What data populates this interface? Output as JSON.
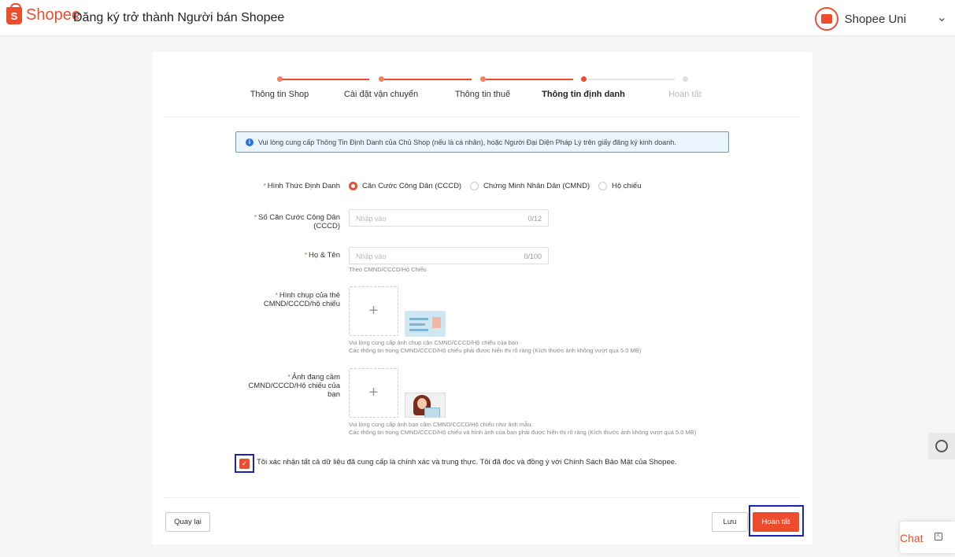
{
  "header": {
    "brand": "Shopee",
    "title": "Đăng ký trở thành Người bán Shopee",
    "account_label": "Shopee Uni"
  },
  "steps": [
    {
      "label": "Thông tin Shop",
      "state": "done"
    },
    {
      "label": "Cài đặt vận chuyển",
      "state": "done"
    },
    {
      "label": "Thông tin thuế",
      "state": "done"
    },
    {
      "label": "Thông tin định danh",
      "state": "active"
    },
    {
      "label": "Hoàn tất",
      "state": "todo"
    }
  ],
  "notice": "Vui lòng cung cấp Thông Tin Định Danh của Chủ Shop (nếu là cá nhân), hoặc Người Đại Diện Pháp Lý trên giấy đăng ký kinh doanh.",
  "form": {
    "id_type": {
      "label": "Hình Thức Định Danh",
      "options": [
        "Căn Cước Công Dân (CCCD)",
        "Chứng Minh Nhân Dân (CMND)",
        "Hộ chiếu"
      ],
      "selected": "Căn Cước Công Dân (CCCD)"
    },
    "id_number": {
      "label_line1": "Số Căn Cước Công Dân",
      "label_line2": "(CCCD)",
      "placeholder": "Nhập vào",
      "counter": "0/12"
    },
    "full_name": {
      "label": "Họ & Tên",
      "placeholder": "Nhập vào",
      "counter": "0/100",
      "hint": "Theo CMND/CCCD/Hộ Chiếu"
    },
    "id_photo": {
      "label_line1": "Hình chụp của thẻ",
      "label_line2": "CMND/CCCD/hộ chiếu",
      "upload_symbol": "+",
      "hint1": "Vui lòng cung cấp ảnh chụp cận CMND/CCCD/Hộ chiếu của bạn",
      "hint2": "Các thông tin trong CMND/CCCD/Hộ chiếu phải được hiển thị rõ ràng (Kích thước ảnh không vượt quá 5.0 MB)"
    },
    "selfie_photo": {
      "label_line1": "Ảnh đang cầm",
      "label_line2": "CMND/CCCD/Hộ chiếu của",
      "label_line3": "bạn",
      "upload_symbol": "+",
      "hint1": "Vui lòng cung cấp ảnh bạn cầm CMND/CCCD/Hộ chiếu như ảnh mẫu.",
      "hint2": "Các thông tin trong CMND/CCCD/Hộ chiếu và hình ảnh của bạn phải được hiển thị rõ ràng (Kích thước ảnh không vượt quá 5.0 MB)"
    },
    "required_mark": "*",
    "consent": {
      "checked": true,
      "text": "Tôi xác nhận tất cả dữ liệu đã cung cấp là chính xác và trung thực. Tôi đã đọc và đồng ý với Chính Sách Bảo Mật của Shopee."
    }
  },
  "buttons": {
    "back": "Quay lại",
    "save": "Lưu",
    "finish": "Hoàn tất"
  },
  "widgets": {
    "chat_label": "Chat"
  },
  "colors": {
    "accent": "#ee4d2d",
    "info_border": "#5a9bd8",
    "highlight": "#1a23b8"
  }
}
